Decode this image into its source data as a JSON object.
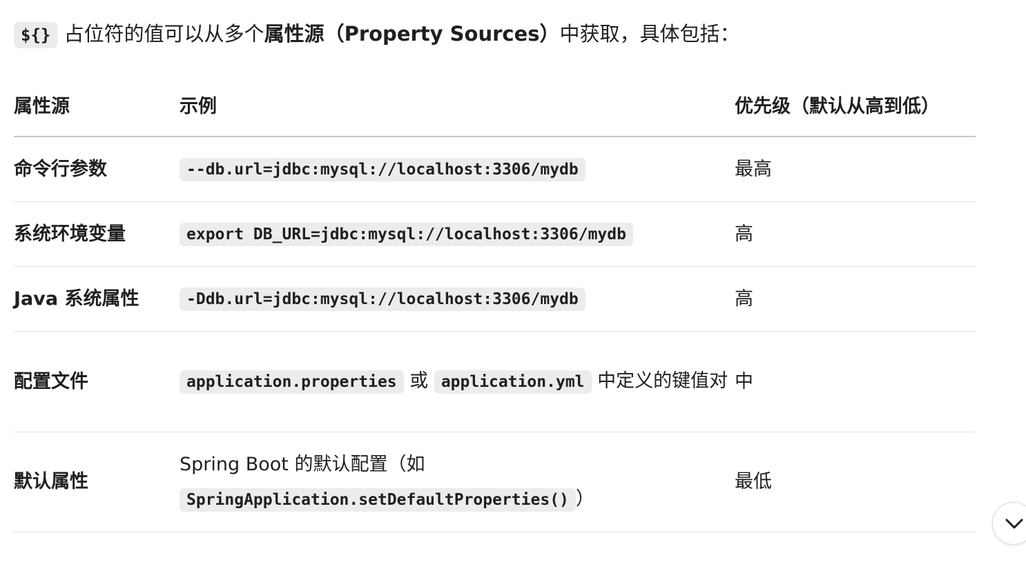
{
  "intro": {
    "code": "${}",
    "text_before": " 占位符的值可以从多个",
    "bold": "属性源（Property Sources）",
    "text_after": "中获取，具体包括："
  },
  "table": {
    "headers": [
      "属性源",
      "示例",
      "优先级（默认从高到低）"
    ],
    "rows": [
      {
        "source": "命令行参数",
        "example_code": "--db.url=jdbc:mysql://localhost:3306/mydb",
        "priority": "最高"
      },
      {
        "source": "系统环境变量",
        "example_code": "export DB_URL=jdbc:mysql://localhost:3306/mydb",
        "priority": "高"
      },
      {
        "source": "Java 系统属性",
        "example_code": "-Ddb.url=jdbc:mysql://localhost:3306/mydb",
        "priority": "高"
      },
      {
        "source": "配置文件",
        "example_code_1": "application.properties",
        "example_text_1": " 或 ",
        "example_code_2": "application.yml",
        "example_text_2": " 中定义的键值对",
        "priority": "中"
      },
      {
        "source": "默认属性",
        "example_text_1": "Spring Boot 的默认配置（如",
        "example_code": "SpringApplication.setDefaultProperties()",
        "example_text_2": "）",
        "priority": "最低"
      }
    ]
  },
  "scroll_button": {
    "icon": "chevron-down-icon"
  }
}
